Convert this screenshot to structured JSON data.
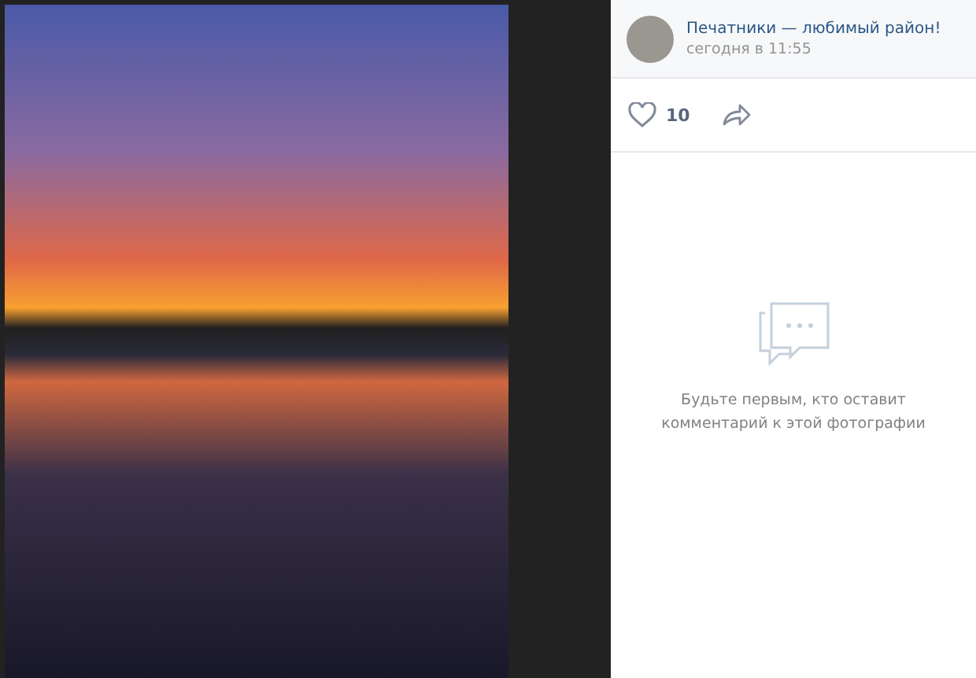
{
  "photo": {
    "kind": "photo"
  },
  "post": {
    "author": "Печатники — любимый район!",
    "time": "сегодня в 11:55"
  },
  "actions": {
    "likes": "10",
    "liked": false
  },
  "comments": {
    "empty_text": "Будьте первым, кто оставит комментарий к этой фотографии"
  }
}
